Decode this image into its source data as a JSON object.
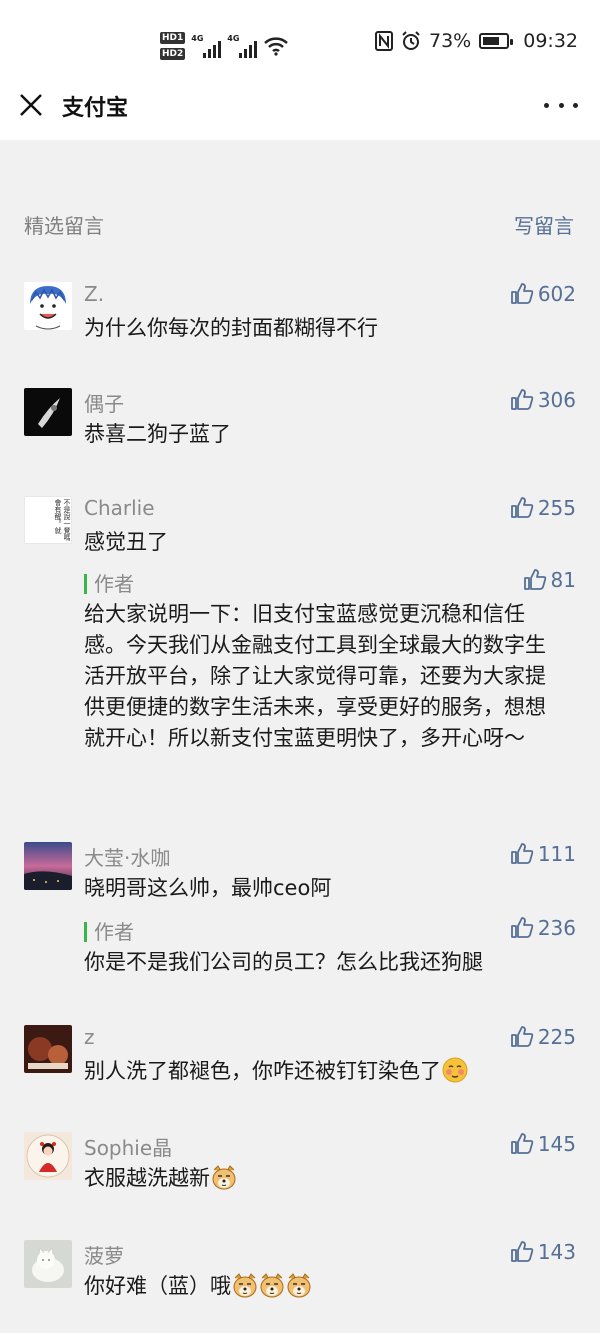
{
  "status_bar": {
    "hd1": "HD1",
    "hd2": "HD2",
    "net1": "4G",
    "net2": "4G",
    "battery": "73%",
    "battery_level": 0.73,
    "time": "09:32"
  },
  "header": {
    "title": "支付宝",
    "close_icon": "close-icon",
    "more_icon": "more-icon"
  },
  "comments_section": {
    "heading": "精选留言",
    "write_label": "写留言"
  },
  "comments": [
    {
      "name": "Z.",
      "likes": "602",
      "text": "为什么你每次的封面都糊得不行"
    },
    {
      "name": "偶子",
      "likes": "306",
      "text": "恭喜二狗子蓝了"
    },
    {
      "name": "Charlie",
      "likes": "255",
      "text": "感觉丑了",
      "avatar_text": [
        "不是",
        "說一覺",
        "嗎會有",
        "醒。",
        "就"
      ],
      "reply": {
        "author": "作者",
        "likes": "81",
        "text": "给大家说明一下：旧支付宝蓝感觉更沉稳和信任感。今天我们从金融支付工具到全球最大的数字生活开放平台，除了让大家觉得可靠，还要为大家提供更便捷的数字生活未来，享受更好的服务，想想就开心！所以新支付宝蓝更明快了，多开心呀～"
      }
    },
    {
      "name": "大莹·水咖",
      "likes": "111",
      "text": "晓明哥这么帅，最帅ceo阿",
      "reply": {
        "author": "作者",
        "likes": "236",
        "text": "你是不是我们公司的员工？怎么比我还狗腿"
      }
    },
    {
      "name": "z",
      "likes": "225",
      "text": "别人洗了都褪色，你咋还被钉钉染色了"
    },
    {
      "name": "Sophie晶",
      "likes": "145",
      "text": "衣服越洗越新"
    },
    {
      "name": "菠萝",
      "likes": "143",
      "text": "你好难（蓝）哦"
    }
  ],
  "colors": {
    "link_blue": "#556f95",
    "author_green": "#39b54a",
    "muted_gray": "#8a8a8a",
    "background": "#f1f1f1"
  }
}
